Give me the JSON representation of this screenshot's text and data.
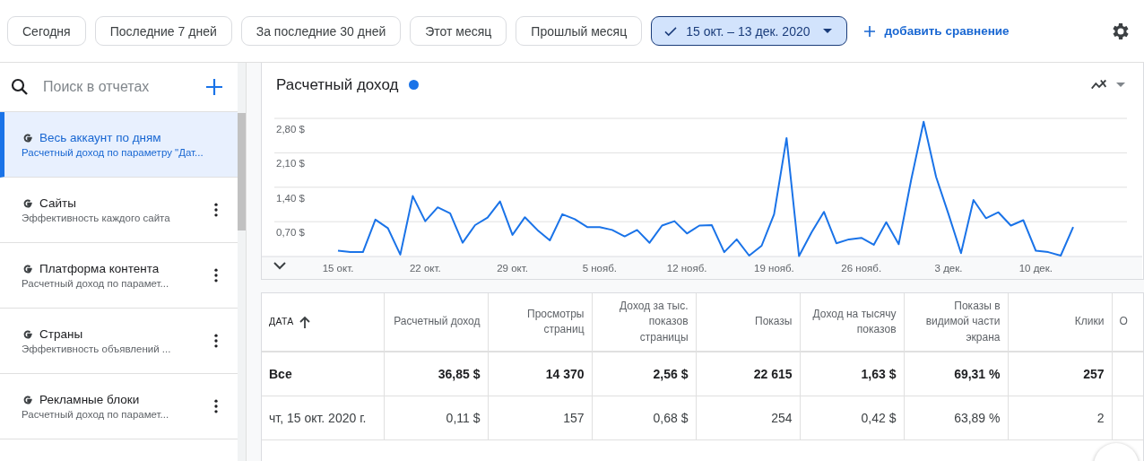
{
  "date_filters": [
    {
      "label": "Сегодня",
      "selected": false
    },
    {
      "label": "Последние 7 дней",
      "selected": false
    },
    {
      "label": "За последние 30 дней",
      "selected": false
    },
    {
      "label": "Этот месяц",
      "selected": false
    },
    {
      "label": "Прошлый месяц",
      "selected": false
    },
    {
      "label": "15 окт. – 13 дек. 2020",
      "selected": true
    }
  ],
  "add_comparison": "добавить сравнение",
  "sidebar": {
    "search": {
      "placeholder": "Поиск в отчетах"
    },
    "items": [
      {
        "title": "Весь аккаунт по дням",
        "subtitle": "Расчетный доход по параметру \"Дат...",
        "selected": true
      },
      {
        "title": "Сайты",
        "subtitle": "Эффективность каждого сайта",
        "selected": false
      },
      {
        "title": "Платформа контента",
        "subtitle": "Расчетный доход по парамет...",
        "selected": false
      },
      {
        "title": "Страны",
        "subtitle": "Эффективность объявлений ...",
        "selected": false
      },
      {
        "title": "Рекламные блоки",
        "subtitle": "Расчетный доход по парамет...",
        "selected": false
      }
    ]
  },
  "chart": {
    "chart_data": {
      "type": "line",
      "title": "Расчетный доход",
      "categories": [
        "15 окт.",
        null,
        null,
        null,
        null,
        null,
        null,
        "22 окт.",
        null,
        null,
        null,
        null,
        null,
        null,
        "29 окт.",
        null,
        null,
        null,
        null,
        null,
        null,
        "5 нояб.",
        null,
        null,
        null,
        null,
        null,
        null,
        "12 нояб.",
        null,
        null,
        null,
        null,
        null,
        null,
        "19 нояб.",
        null,
        null,
        null,
        null,
        null,
        null,
        "26 нояб.",
        null,
        null,
        null,
        null,
        null,
        null,
        "3 дек.",
        null,
        null,
        null,
        null,
        null,
        null,
        "10 дек.",
        null,
        null,
        null
      ],
      "series": [
        {
          "color": "#1a73e8",
          "values": [
            0.11,
            0.08,
            0.08,
            0.74,
            0.57,
            0.03,
            1.22,
            0.71,
            0.99,
            0.87,
            0.27,
            0.63,
            0.78,
            1.11,
            0.43,
            0.79,
            0.53,
            0.32,
            0.85,
            0.75,
            0.59,
            0.59,
            0.53,
            0.4,
            0.53,
            0.27,
            0.62,
            0.71,
            0.46,
            0.62,
            0.63,
            0.08,
            0.34,
            0.01,
            0.21,
            0.85,
            2.4,
            0.0,
            0.48,
            0.9,
            0.26,
            0.34,
            0.37,
            0.23,
            0.69,
            0.24,
            1.55,
            2.73,
            1.61,
            0.85,
            0.06,
            1.14,
            0.77,
            0.89,
            0.62,
            0.73,
            0.11,
            0.08,
            0.01,
            0.59
          ]
        }
      ],
      "ylim": [
        0,
        2.8
      ],
      "grid": true,
      "yticks": [
        {
          "value": 0.7,
          "label": "0,70 $"
        },
        {
          "value": 1.4,
          "label": "1,40 $"
        },
        {
          "value": 2.1,
          "label": "2,10 $"
        },
        {
          "value": 2.8,
          "label": "2,80 $"
        }
      ]
    }
  },
  "table": {
    "columns": [
      {
        "label": "ДАТА",
        "sorted": true
      },
      {
        "label": "Расчетный доход"
      },
      {
        "label": "Просмотры страниц"
      },
      {
        "label": "Доход за тыс. показов страницы"
      },
      {
        "label": "Показы"
      },
      {
        "label": "Доход на тысячу показов"
      },
      {
        "label": "Показы в видимой части экрана"
      },
      {
        "label": "Клики"
      },
      {
        "label": "О"
      }
    ],
    "rows": [
      {
        "kind": "total",
        "cells": [
          "Все",
          "36,85 $",
          "14 370",
          "2,56 $",
          "22 615",
          "1,63 $",
          "69,31 %",
          "257"
        ]
      },
      {
        "kind": "day",
        "cells": [
          "чт, 15 окт. 2020 г.",
          "0,11 $",
          "157",
          "0,68 $",
          "254",
          "0,42 $",
          "63,89 %",
          "2"
        ]
      }
    ]
  }
}
